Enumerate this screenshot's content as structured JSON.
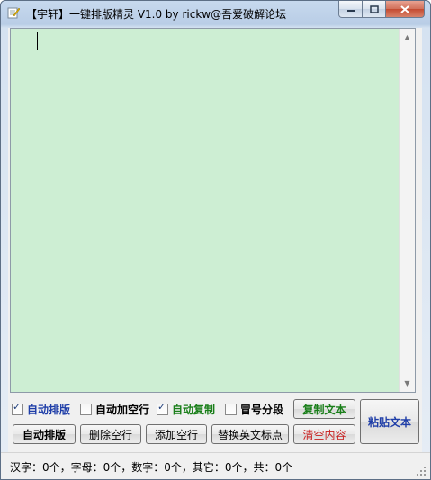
{
  "window": {
    "title": "【宇轩】一键排版精灵 V1.0 by rickw@吾爱破解论坛",
    "icon": "notepad-icon",
    "caption_buttons": [
      "minimize-icon",
      "maximize-icon",
      "close-icon"
    ]
  },
  "editor": {
    "text": "",
    "background": "#cdeed3"
  },
  "options": {
    "auto_layout": {
      "label": "自动排版",
      "checked": true,
      "color": "#1f3ea8"
    },
    "auto_blank_line": {
      "label": "自动加空行",
      "checked": false,
      "color": "#000000"
    },
    "auto_copy": {
      "label": "自动复制",
      "checked": true,
      "color": "#1a7f1a"
    },
    "colon_split": {
      "label": "冒号分段",
      "checked": false,
      "color": "#000000"
    }
  },
  "buttons": {
    "copy_text": {
      "label": "复制文本",
      "color": "#1a7f1a"
    },
    "paste_text": {
      "label": "粘贴文本",
      "color": "#1f3ea8"
    },
    "auto_layout": {
      "label": "自动排版",
      "color": "#000000"
    },
    "delete_blank": {
      "label": "删除空行",
      "color": "#000000"
    },
    "add_blank": {
      "label": "添加空行",
      "color": "#000000"
    },
    "replace_punct": {
      "label": "替换英文标点",
      "color": "#000000"
    },
    "clear_content": {
      "label": "清空内容",
      "color": "#c81e1e"
    }
  },
  "statusbar": {
    "text": "汉字：0个，字母：0个，数字：0个，其它：0个，共：0个"
  }
}
